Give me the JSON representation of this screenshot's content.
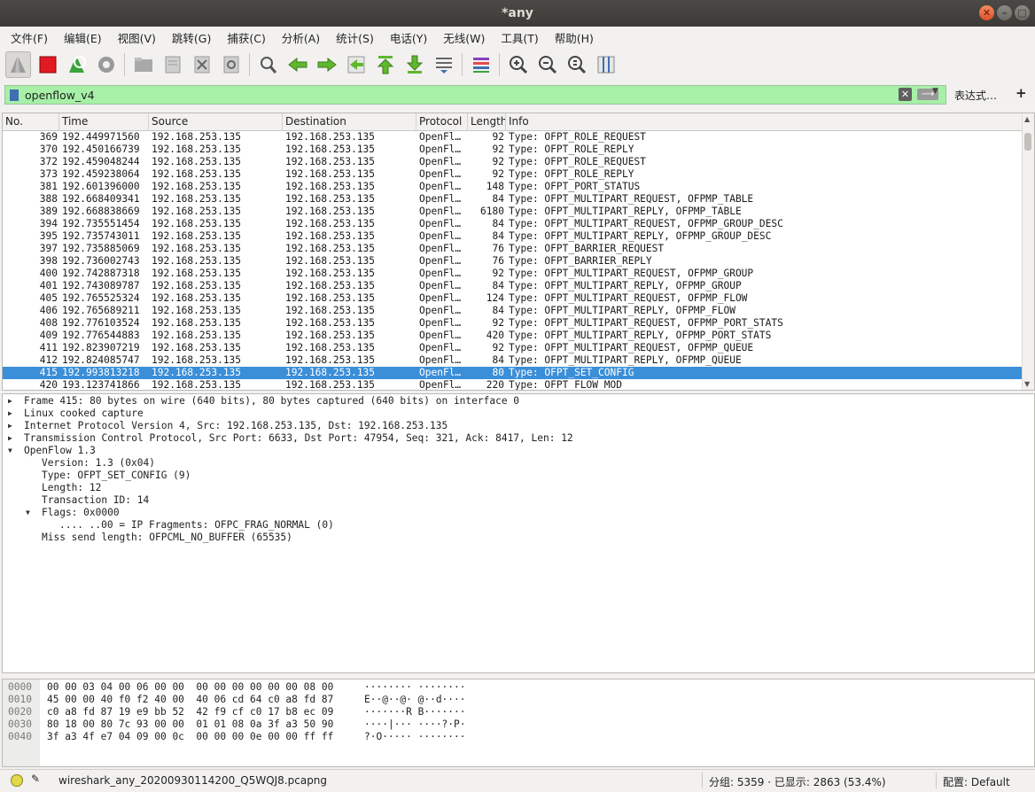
{
  "window": {
    "title": "*any"
  },
  "menu": [
    "文件(F)",
    "编辑(E)",
    "视图(V)",
    "跳转(G)",
    "捕获(C)",
    "分析(A)",
    "统计(S)",
    "电话(Y)",
    "无线(W)",
    "工具(T)",
    "帮助(H)"
  ],
  "toolbar": [
    "start-capture-icon",
    "stop-capture-icon",
    "restart-capture-icon",
    "capture-options-icon",
    "open-file-icon",
    "save-file-icon",
    "close-file-icon",
    "reload-file-icon",
    "find-packet-icon",
    "go-back-icon",
    "go-forward-icon",
    "go-to-packet-icon",
    "first-packet-icon",
    "last-packet-icon",
    "autoscroll-icon",
    "colorize-icon",
    "zoom-in-icon",
    "zoom-out-icon",
    "normal-size-icon",
    "resize-columns-icon"
  ],
  "filter": {
    "value": "openflow_v4",
    "expression_label": "表达式…",
    "add_label": "+"
  },
  "packet_list": {
    "columns": [
      "No.",
      "Time",
      "Source",
      "Destination",
      "Protocol",
      "Length",
      "Info"
    ],
    "rows": [
      [
        "369",
        "192.449971560",
        "192.168.253.135",
        "192.168.253.135",
        "OpenFl…",
        "92",
        "Type: OFPT_ROLE_REQUEST"
      ],
      [
        "370",
        "192.450166739",
        "192.168.253.135",
        "192.168.253.135",
        "OpenFl…",
        "92",
        "Type: OFPT_ROLE_REPLY"
      ],
      [
        "372",
        "192.459048244",
        "192.168.253.135",
        "192.168.253.135",
        "OpenFl…",
        "92",
        "Type: OFPT_ROLE_REQUEST"
      ],
      [
        "373",
        "192.459238064",
        "192.168.253.135",
        "192.168.253.135",
        "OpenFl…",
        "92",
        "Type: OFPT_ROLE_REPLY"
      ],
      [
        "381",
        "192.601396000",
        "192.168.253.135",
        "192.168.253.135",
        "OpenFl…",
        "148",
        "Type: OFPT_PORT_STATUS"
      ],
      [
        "388",
        "192.668409341",
        "192.168.253.135",
        "192.168.253.135",
        "OpenFl…",
        "84",
        "Type: OFPT_MULTIPART_REQUEST, OFPMP_TABLE"
      ],
      [
        "389",
        "192.668838669",
        "192.168.253.135",
        "192.168.253.135",
        "OpenFl…",
        "6180",
        "Type: OFPT_MULTIPART_REPLY, OFPMP_TABLE"
      ],
      [
        "394",
        "192.735551454",
        "192.168.253.135",
        "192.168.253.135",
        "OpenFl…",
        "84",
        "Type: OFPT_MULTIPART_REQUEST, OFPMP_GROUP_DESC"
      ],
      [
        "395",
        "192.735743011",
        "192.168.253.135",
        "192.168.253.135",
        "OpenFl…",
        "84",
        "Type: OFPT_MULTIPART_REPLY, OFPMP_GROUP_DESC"
      ],
      [
        "397",
        "192.735885069",
        "192.168.253.135",
        "192.168.253.135",
        "OpenFl…",
        "76",
        "Type: OFPT_BARRIER_REQUEST"
      ],
      [
        "398",
        "192.736002743",
        "192.168.253.135",
        "192.168.253.135",
        "OpenFl…",
        "76",
        "Type: OFPT_BARRIER_REPLY"
      ],
      [
        "400",
        "192.742887318",
        "192.168.253.135",
        "192.168.253.135",
        "OpenFl…",
        "92",
        "Type: OFPT_MULTIPART_REQUEST, OFPMP_GROUP"
      ],
      [
        "401",
        "192.743089787",
        "192.168.253.135",
        "192.168.253.135",
        "OpenFl…",
        "84",
        "Type: OFPT_MULTIPART_REPLY, OFPMP_GROUP"
      ],
      [
        "405",
        "192.765525324",
        "192.168.253.135",
        "192.168.253.135",
        "OpenFl…",
        "124",
        "Type: OFPT_MULTIPART_REQUEST, OFPMP_FLOW"
      ],
      [
        "406",
        "192.765689211",
        "192.168.253.135",
        "192.168.253.135",
        "OpenFl…",
        "84",
        "Type: OFPT_MULTIPART_REPLY, OFPMP_FLOW"
      ],
      [
        "408",
        "192.776103524",
        "192.168.253.135",
        "192.168.253.135",
        "OpenFl…",
        "92",
        "Type: OFPT_MULTIPART_REQUEST, OFPMP_PORT_STATS"
      ],
      [
        "409",
        "192.776544883",
        "192.168.253.135",
        "192.168.253.135",
        "OpenFl…",
        "420",
        "Type: OFPT_MULTIPART_REPLY, OFPMP_PORT_STATS"
      ],
      [
        "411",
        "192.823907219",
        "192.168.253.135",
        "192.168.253.135",
        "OpenFl…",
        "92",
        "Type: OFPT_MULTIPART_REQUEST, OFPMP_QUEUE"
      ],
      [
        "412",
        "192.824085747",
        "192.168.253.135",
        "192.168.253.135",
        "OpenFl…",
        "84",
        "Type: OFPT_MULTIPART_REPLY, OFPMP_QUEUE"
      ],
      [
        "415",
        "192.993813218",
        "192.168.253.135",
        "192.168.253.135",
        "OpenFl…",
        "80",
        "Type: OFPT_SET_CONFIG"
      ],
      [
        "420",
        "193.123741866",
        "192.168.253.135",
        "192.168.253.135",
        "OpenFl…",
        "220",
        "Type: OFPT_FLOW_MOD"
      ]
    ],
    "selected_row": 19
  },
  "details": [
    {
      "level": 0,
      "state": "collapsed",
      "text": "Frame 415: 80 bytes on wire (640 bits), 80 bytes captured (640 bits) on interface 0"
    },
    {
      "level": 0,
      "state": "collapsed",
      "text": "Linux cooked capture"
    },
    {
      "level": 0,
      "state": "collapsed",
      "text": "Internet Protocol Version 4, Src: 192.168.253.135, Dst: 192.168.253.135"
    },
    {
      "level": 0,
      "state": "collapsed",
      "text": "Transmission Control Protocol, Src Port: 6633, Dst Port: 47954, Seq: 321, Ack: 8417, Len: 12"
    },
    {
      "level": 0,
      "state": "expanded",
      "text": "OpenFlow 1.3"
    },
    {
      "level": 1,
      "state": "leaf",
      "text": "Version: 1.3 (0x04)"
    },
    {
      "level": 1,
      "state": "leaf",
      "text": "Type: OFPT_SET_CONFIG (9)"
    },
    {
      "level": 1,
      "state": "leaf",
      "text": "Length: 12"
    },
    {
      "level": 1,
      "state": "leaf",
      "text": "Transaction ID: 14"
    },
    {
      "level": 1,
      "state": "expanded",
      "text": "Flags: 0x0000"
    },
    {
      "level": 2,
      "state": "leaf",
      "text": ".... ..00 = IP Fragments: OFPC_FRAG_NORMAL (0)"
    },
    {
      "level": 1,
      "state": "leaf",
      "text": "Miss send length: OFPCML_NO_BUFFER (65535)"
    }
  ],
  "hex": [
    {
      "offset": "0000",
      "bytes": "00 00 03 04 00 06 00 00  00 00 00 00 00 00 08 00",
      "ascii": "········ ········"
    },
    {
      "offset": "0010",
      "bytes": "45 00 00 40 f0 f2 40 00  40 06 cd 64 c0 a8 fd 87",
      "ascii": "E··@··@· @··d····"
    },
    {
      "offset": "0020",
      "bytes": "c0 a8 fd 87 19 e9 bb 52  42 f9 cf c0 17 b8 ec 09",
      "ascii": "·······R B·······"
    },
    {
      "offset": "0030",
      "bytes": "80 18 00 80 7c 93 00 00  01 01 08 0a 3f a3 50 90",
      "ascii": "····|··· ····?·P·"
    },
    {
      "offset": "0040",
      "bytes": "3f a3 4f e7 04 09 00 0c  00 00 00 0e 00 00 ff ff",
      "ascii": "?·O····· ········"
    }
  ],
  "status": {
    "file": "wireshark_any_20200930114200_Q5WQJ8.pcapng",
    "stats": "分组: 5359 · 已显示: 2863 (53.4%)",
    "profile": "配置: Default"
  }
}
